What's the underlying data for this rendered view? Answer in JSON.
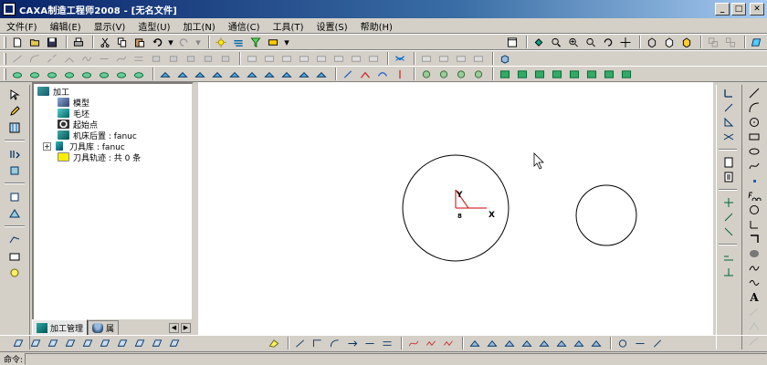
{
  "window": {
    "title": "CAXA制造工程师2008  - [无名文件]",
    "controls": {
      "minimize": "_",
      "maximize": "□",
      "close": "✕"
    }
  },
  "menu": [
    "文件(F)",
    "编辑(E)",
    "显示(V)",
    "造型(U)",
    "加工(N)",
    "通信(C)",
    "工具(T)",
    "设置(S)",
    "帮助(H)"
  ],
  "tree": {
    "root": "加工",
    "children": [
      {
        "label": "模型",
        "icon": "model-icon"
      },
      {
        "label": "毛坯",
        "icon": "blank-icon"
      },
      {
        "label": "起始点",
        "icon": "start-point-icon"
      },
      {
        "label": "机床后置 : fanuc",
        "icon": "post-processor-icon"
      },
      {
        "label": "刀具库 : fanuc",
        "icon": "tool-library-icon",
        "expandable": true
      },
      {
        "label": "刀具轨迹 : 共 0 条",
        "icon": "toolpath-icon"
      }
    ]
  },
  "tabs": [
    {
      "label": "加工管理",
      "active": true
    },
    {
      "label": "属",
      "active": false
    }
  ],
  "canvas": {
    "axis_labels": {
      "x": "X",
      "y": "Y",
      "origin": "8"
    }
  },
  "statusbar": {
    "command_prompt": "命令:"
  },
  "colors": {
    "titlebar": "#0a246a",
    "chrome": "#d4d0c8",
    "axis": "#cc0000"
  }
}
